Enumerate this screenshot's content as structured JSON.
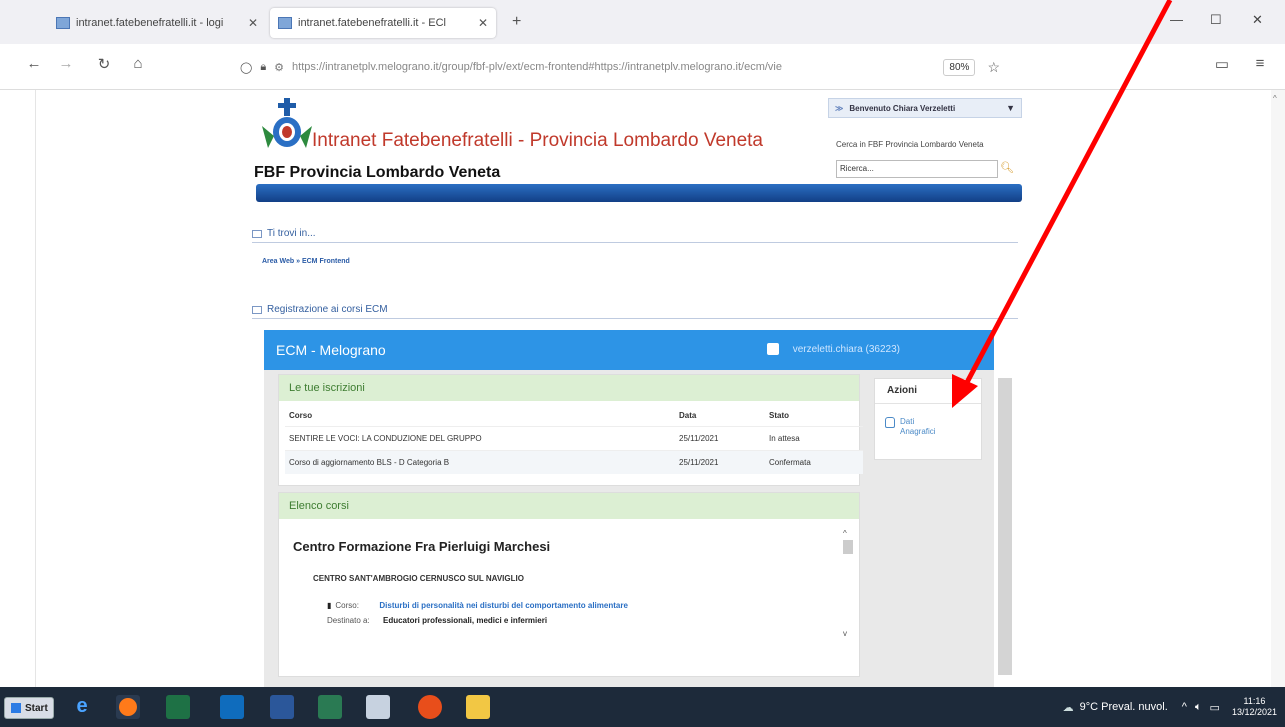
{
  "browser": {
    "tabs": [
      {
        "label": "intranet.fatebenefratelli.it - logi",
        "active": false
      },
      {
        "label": "intranet.fatebenefratelli.it - ECl",
        "active": true
      }
    ],
    "new_tab_label": "+",
    "url": "https://intranetplv.melograno.it/group/fbf-plv/ext/ecm-frontend#https://intranetplv.melograno.it/ecm/vie",
    "zoom": "80%",
    "window_controls": {
      "minimize": "—",
      "maximize": "☐",
      "close": "✕"
    }
  },
  "site": {
    "title": "Intranet Fatebenefratelli - Provincia Lombardo Veneta",
    "org": "FBF Provincia Lombardo Veneta",
    "welcome": "Benvenuto Chiara Verzeletti",
    "search_label": "Cerca in FBF Provincia Lombardo Veneta",
    "search_placeholder": "Ricerca..."
  },
  "sections": {
    "location_title": "Ti trovi in...",
    "breadcrumb": "Area Web » ECM Frontend",
    "registration_title": "Registrazione ai corsi ECM"
  },
  "ecm": {
    "title": "ECM - Melograno",
    "user": "verzeletti.chiara (36223)",
    "iscrizioni": {
      "title": "Le tue iscrizioni",
      "headers": [
        "Corso",
        "Data",
        "Stato"
      ],
      "rows": [
        [
          "SENTIRE LE VOCI: LA CONDUZIONE DEL GRUPPO",
          "25/11/2021",
          "In attesa"
        ],
        [
          "Corso di aggiornamento BLS - D Categoria B",
          "25/11/2021",
          "Confermata"
        ]
      ]
    },
    "azioni": {
      "title": "Azioni",
      "link_line1": "Dati",
      "link_line2": "Anagrafici"
    },
    "elenco": {
      "title": "Elenco corsi",
      "center": "Centro Formazione Fra Pierluigi Marchesi",
      "site": "CENTRO SANT'AMBROGIO CERNUSCO SUL NAVIGLIO",
      "course_label": "Corso:",
      "course_name": "Disturbi di personalità nei disturbi del comportamento alimentare",
      "target_label": "Destinato a:",
      "target_value": "Educatori professionali, medici e infermieri"
    }
  },
  "taskbar": {
    "start": "Start",
    "weather": "9°C Preval. nuvol.",
    "time": "11:16",
    "date": "13/12/2021"
  },
  "colors": {
    "ecm_header": "#2d94e6",
    "card_header": "#dcefd3",
    "arrow": "#ff0000",
    "site_title": "#c0392b"
  }
}
